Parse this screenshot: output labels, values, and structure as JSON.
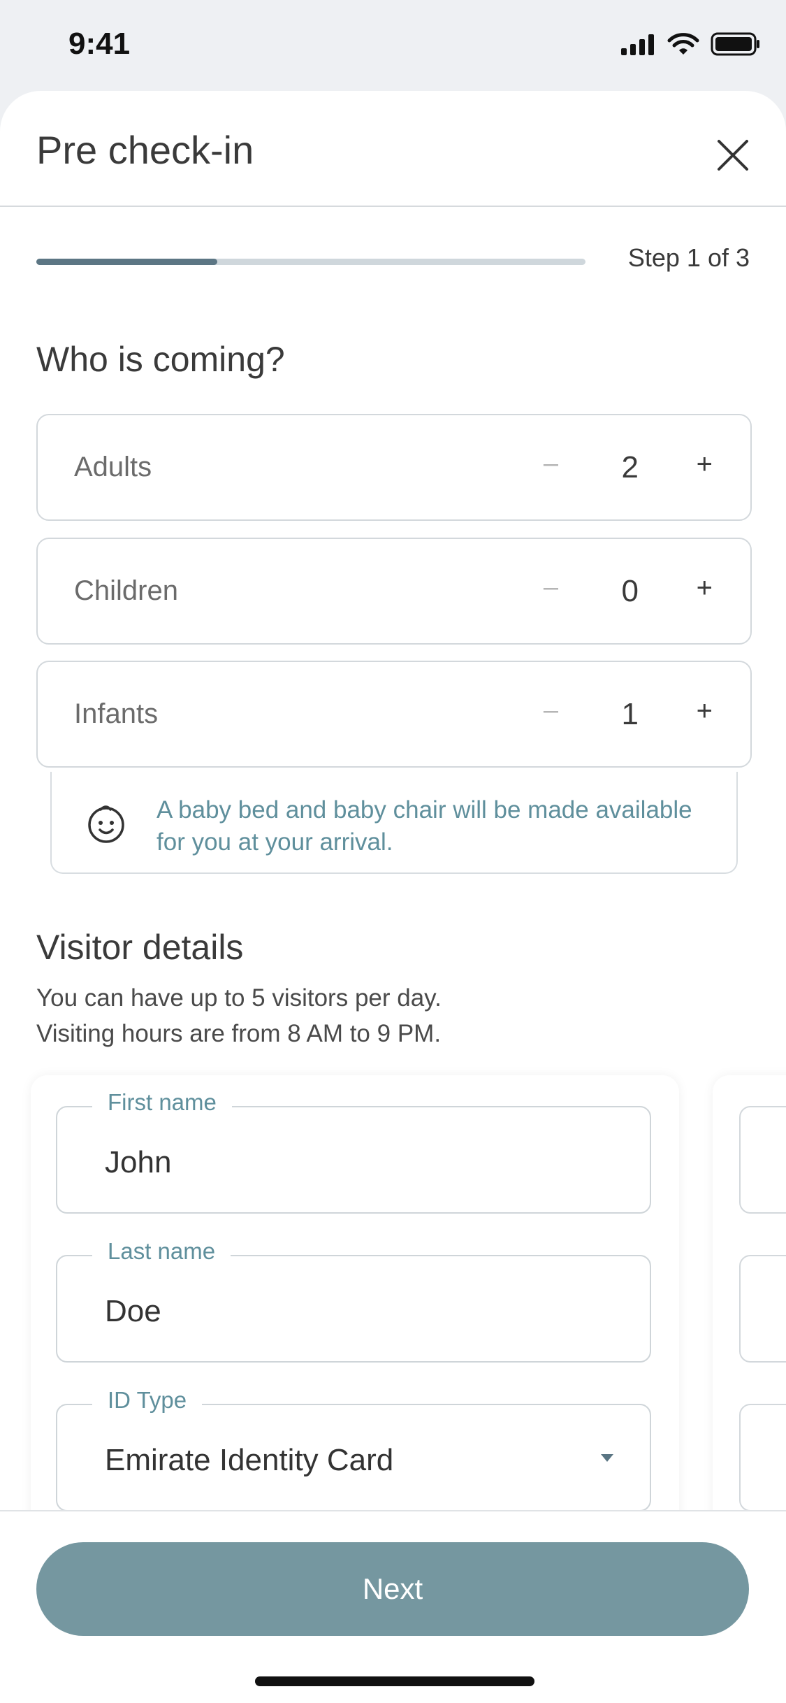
{
  "status_bar": {
    "time": "9:41"
  },
  "header": {
    "title": "Pre check-in"
  },
  "progress": {
    "step_label": "Step 1 of 3",
    "fraction": 0.33
  },
  "guests": {
    "title": "Who is coming?",
    "rows": [
      {
        "label": "Adults",
        "value": "2"
      },
      {
        "label": "Children",
        "value": "0"
      },
      {
        "label": "Infants",
        "value": "1"
      }
    ],
    "minus_symbol": "–",
    "plus_symbol": "+",
    "infant_note": "A baby bed and baby chair will be made available for you at your arrival."
  },
  "visitors": {
    "title": "Visitor details",
    "subtitle_line1": "You can have up to 5 visitors per day.",
    "subtitle_line2": "Visiting hours are from 8 AM to 9 PM.",
    "fields": [
      {
        "label": "First name",
        "value": "John"
      },
      {
        "label": "Last name",
        "value": "Doe"
      },
      {
        "label": "ID Type",
        "value": "Emirate Identity Card"
      }
    ]
  },
  "footer": {
    "next_label": "Next"
  },
  "colors": {
    "accent": "#7597a0",
    "progress": "#5c7684",
    "info_text": "#5f8f9c"
  }
}
